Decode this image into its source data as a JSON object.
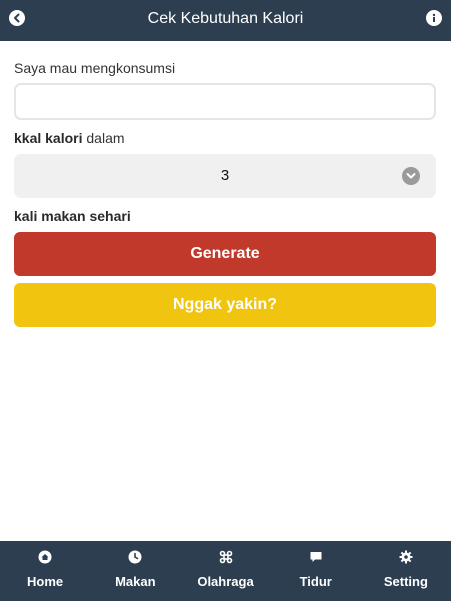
{
  "header": {
    "title": "Cek Kebutuhan Kalori",
    "back_icon": "chevron-left-icon",
    "info_icon": "info-icon"
  },
  "form": {
    "consume_label": "Saya mau mengkonsumsi",
    "consume_value": "",
    "kcal_label_bold": "kkal kalori",
    "kcal_label_rest": " dalam",
    "meals_selected": "3",
    "meals_label": "kali makan sehari"
  },
  "buttons": {
    "generate": "Generate",
    "unsure": "Nggak yakin?"
  },
  "colors": {
    "header_bg": "#2d3e50",
    "generate_bg": "#c0392b",
    "unsure_bg": "#f1c40f"
  },
  "nav": {
    "items": [
      {
        "label": "Home",
        "icon": "home-icon"
      },
      {
        "label": "Makan",
        "icon": "clock-icon"
      },
      {
        "label": "Olahraga",
        "icon": "command-icon"
      },
      {
        "label": "Tidur",
        "icon": "comment-icon"
      },
      {
        "label": "Setting",
        "icon": "gear-icon"
      }
    ]
  }
}
